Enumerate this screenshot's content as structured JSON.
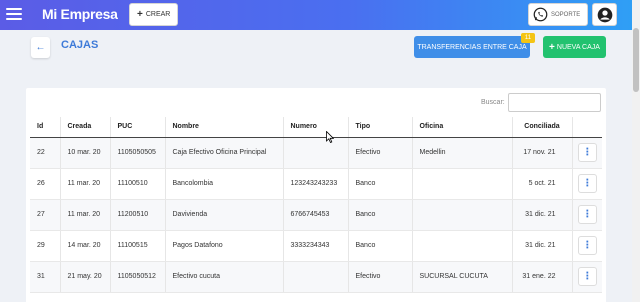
{
  "topbar": {
    "logo": "Mi Empresa",
    "create_label": "CREAR",
    "support_label": "SOPORTE",
    "icons": {
      "menu": "hamburger-icon",
      "support": "whatsapp-icon",
      "user": "user-circle-icon"
    }
  },
  "header": {
    "title": "CAJAS",
    "transfer_label": "TRANSFERENCIAS ENTRE CAJA",
    "transfer_badge": "11",
    "new_label": "NUEVA CAJA"
  },
  "search": {
    "label": "Buscar:",
    "value": ""
  },
  "table": {
    "columns": [
      "Id",
      "Creada",
      "PUC",
      "Nombre",
      "Numero",
      "Tipo",
      "Oficina",
      "Conciliada"
    ],
    "rows": [
      {
        "id": "22",
        "creada": "10 mar. 20",
        "puc": "1105050505",
        "nombre": "Caja Efectivo Oficina Principal",
        "numero": "",
        "tipo": "Efectivo",
        "oficina": "Medellin",
        "conciliada": "17 nov. 21"
      },
      {
        "id": "26",
        "creada": "11 mar. 20",
        "puc": "11100510",
        "nombre": "Bancolombia",
        "numero": "123243243233",
        "tipo": "Banco",
        "oficina": "",
        "conciliada": "5 oct. 21"
      },
      {
        "id": "27",
        "creada": "11 mar. 20",
        "puc": "11200510",
        "nombre": "Davivienda",
        "numero": "6766745453",
        "tipo": "Banco",
        "oficina": "",
        "conciliada": "31 dic. 21"
      },
      {
        "id": "29",
        "creada": "14 mar. 20",
        "puc": "11100515",
        "nombre": "Pagos Datafono",
        "numero": "3333234343",
        "tipo": "Banco",
        "oficina": "",
        "conciliada": "31 dic. 21"
      },
      {
        "id": "31",
        "creada": "21 may. 20",
        "puc": "1105050512",
        "nombre": "Efectivo cucuta",
        "numero": "",
        "tipo": "Efectivo",
        "oficina": "SUCURSAL CUCUTA",
        "conciliada": "31 ene. 22"
      }
    ]
  },
  "colors": {
    "accent": "#3d7ad8",
    "transfer_bg": "#3f8ee8",
    "new_bg": "#22c26f",
    "badge_bg": "#f4c414"
  }
}
